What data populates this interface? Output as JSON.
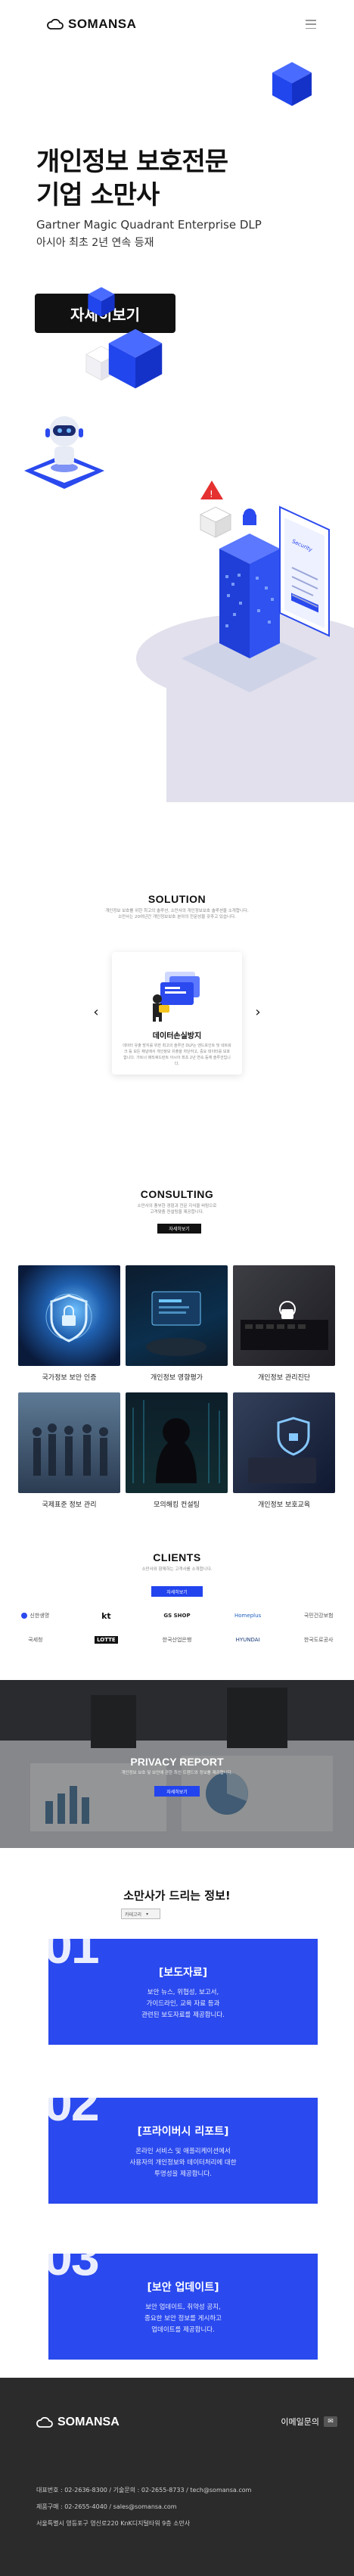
{
  "header": {
    "brand": "SOMANSA"
  },
  "hero": {
    "title_line1": "개인정보 보호전문",
    "title_line2": "기업 소만사",
    "sub1": "Gartner Magic Quadrant Enterprise DLP",
    "sub2": "아시아 최초 2년 연속 등재",
    "cta": "자세히보기",
    "illustration_label": "Security"
  },
  "solution": {
    "title": "SOLUTION",
    "desc1": "개인정보 보호를 위한 최고의 솔루션, 소만사의 개인정보보호 솔루션을 소개합니다.",
    "desc2": "소만사는 20여년간 개인정보보호 분야의 전문성을 갖추고 있습니다.",
    "card_title": "데이터손실방지",
    "card_desc1": "데이터 유출 방지를 위한 최고의 솔루션 DLP는 엔드포인트 및 네트워크",
    "card_desc2": "등 모든 채널에서 개인정보 유출을 차단하고, 중요 데이터를 보호합니다.",
    "card_desc3": "가트너 매직쿼드런트 아시아 최초 2년 연속 등재 솔루션입니다."
  },
  "consulting": {
    "title": "CONSULTING",
    "desc1": "소만사의 풍부한 경험과 전문 지식을 바탕으로",
    "desc2": "고객맞춤 컨설팅을 제공합니다.",
    "btn": "자세히보기",
    "items": [
      {
        "label": "국가정보 보안 인증"
      },
      {
        "label": "개인정보 영향평가"
      },
      {
        "label": "개인정보 관리진단"
      },
      {
        "label": "국제표준 정보 관리"
      },
      {
        "label": "모의해킹 컨설팅"
      },
      {
        "label": "개인정보 보호교육"
      }
    ]
  },
  "clients": {
    "title": "CLIENTS",
    "desc": "소만사와 함께하는 고객사를 소개합니다.",
    "btn": "자세히보기",
    "logos": [
      "신한생명",
      "kt",
      "GS SHOP",
      "Homeplus",
      "국민건강보험",
      "국세청",
      "LOTTE",
      "한국산업은행",
      "HYUNDAI",
      "한국도로공사"
    ]
  },
  "report": {
    "title": "PRIVACY REPORT",
    "desc": "개인정보 보호 및 보안에 관한 최신 트렌드와 정보를 제공합니다.",
    "btn": "자세히보기"
  },
  "info": {
    "title": "소만사가 드리는 정보!",
    "select": "카테고리",
    "boxes": [
      {
        "num": "01",
        "title": "[보도자료]",
        "l1": "보안 뉴스, 위협성, 보고서,",
        "l2": "가이드라인, 교육 자료 등과",
        "l3": "관련된 보도자료를 제공합니다."
      },
      {
        "num": "02",
        "title": "[프라이버시 리포트]",
        "l1": "온라인 서비스 및 애플리케이션에서",
        "l2": "사용자의 개인정보와 데이터처리에 대한",
        "l3": "투명성을 제공합니다."
      },
      {
        "num": "03",
        "title": "[보안 업데이트]",
        "l1": "보안 업데이트, 취약성 공지,",
        "l2": "중요한 보안 정보를 게시하고",
        "l3": "업데이트를 제공합니다."
      }
    ]
  },
  "footer": {
    "brand": "SOMANSA",
    "email_label": "이메일문의",
    "line1": "대표번호 : 02-2636-8300 / 기술문의 : 02-2655-8733 / tech@somansa.com",
    "line2": "제품구매 : 02-2655-4040 / sales@somansa.com",
    "line3": "서울특별시 영등포구 영신로220 KnK디지털타워 9층 소만사"
  },
  "colors": {
    "accent": "#2a49ee",
    "dark": "#111111",
    "footer_bg": "#2b2b2b"
  }
}
